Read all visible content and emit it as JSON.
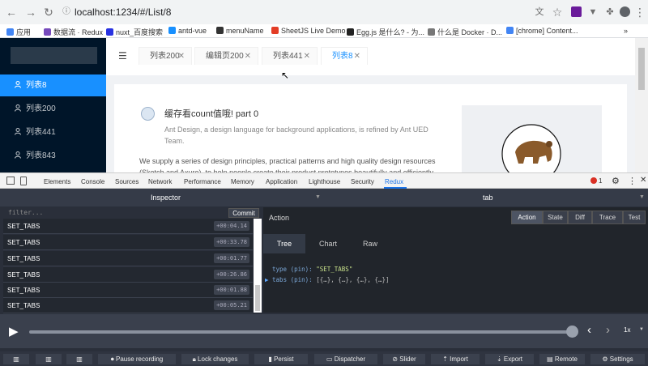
{
  "browser": {
    "url": "localhost:1234/#/List/8",
    "bookmarks": [
      {
        "label": "应用",
        "color": "#4285f4"
      },
      {
        "label": "数据流 · Redux",
        "color": "#764abc"
      },
      {
        "label": "nuxt_百度搜索",
        "color": "#2932e1"
      },
      {
        "label": "antd-vue",
        "color": "#1890ff"
      },
      {
        "label": "menuName",
        "color": "#333333"
      },
      {
        "label": "SheetJS Live Demo",
        "color": "#e33d26"
      },
      {
        "label": "Egg.js 是什么? - 为...",
        "color": "#222222"
      },
      {
        "label": "什么是 Docker · D...",
        "color": "#777777"
      },
      {
        "label": "[chrome] Content...",
        "color": "#4285f4"
      }
    ]
  },
  "app": {
    "menu": [
      {
        "label": "列表8",
        "active": true
      },
      {
        "label": "列表200",
        "active": false
      },
      {
        "label": "列表441",
        "active": false
      },
      {
        "label": "列表843",
        "active": false
      }
    ],
    "tabs": [
      {
        "label": "列表200",
        "active": false
      },
      {
        "label": "编辑页200",
        "active": false
      },
      {
        "label": "列表441",
        "active": false
      },
      {
        "label": "列表8",
        "active": true
      }
    ],
    "card": {
      "title": "缓存看count值哦! part 0",
      "desc": "Ant Design, a design language for background applications, is refined by Ant UED Team.",
      "body": "We supply a series of design principles, practical patterns and high quality design resources (Sketch and Axure), to help people create their product prototypes beautifully and efficiently."
    }
  },
  "devtools": {
    "tabs": [
      "Elements",
      "Console",
      "Sources",
      "Network",
      "Performance",
      "Memory",
      "Application",
      "Lighthouse",
      "Security",
      "Redux"
    ],
    "error_count": "1",
    "inspector_label": "Inspector",
    "instance_label": "tab",
    "filter_placeholder": "filter...",
    "commit_label": "Commit",
    "actions": [
      {
        "name": "SET_TABS",
        "time": "+00:04.14"
      },
      {
        "name": "SET_TABS",
        "time": "+00:33.78"
      },
      {
        "name": "SET_TABS",
        "time": "+00:01.77"
      },
      {
        "name": "SET_TABS",
        "time": "+00:26.86"
      },
      {
        "name": "SET_TABS",
        "time": "+00:01.88"
      },
      {
        "name": "SET_TABS",
        "time": "+00:05.21"
      }
    ],
    "pane_title": "Action",
    "modes": [
      "Action",
      "State",
      "Diff",
      "Trace",
      "Test"
    ],
    "subtabs": [
      "Tree",
      "Chart",
      "Raw"
    ],
    "tree": {
      "type_key": "type (pin):",
      "type_val": "\"SET_TABS\"",
      "tabs_key": "tabs (pin):",
      "tabs_val": "[{…}, {…}, {…}, {…}]"
    },
    "speed": "1x",
    "bottom": [
      "Pause recording",
      "Lock changes",
      "Persist",
      "Dispatcher",
      "Slider",
      "Import",
      "Export",
      "Remote",
      "Settings"
    ]
  }
}
